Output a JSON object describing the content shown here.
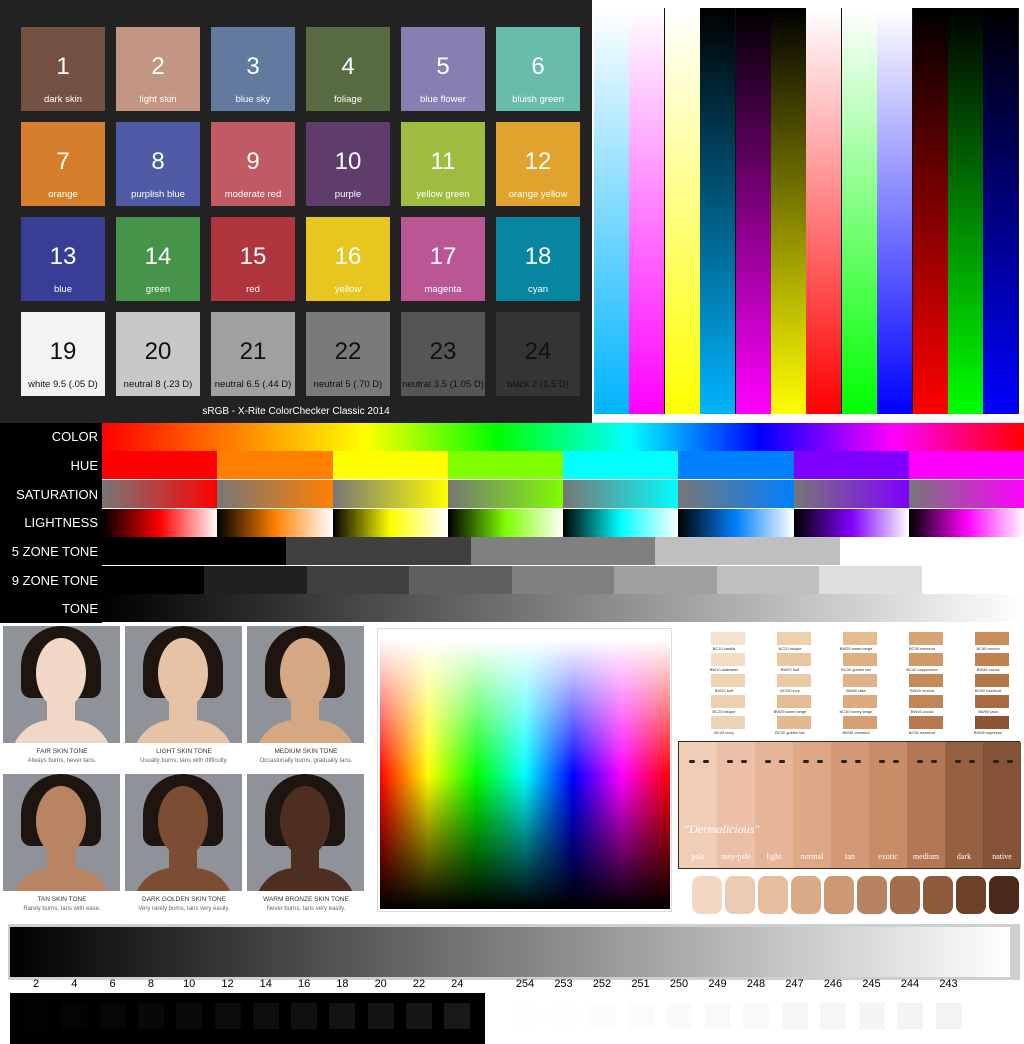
{
  "colorchecker": {
    "caption": "sRGB - X-Rite ColorChecker Classic 2014",
    "patches": [
      {
        "num": "1",
        "name": "dark skin",
        "color": "#735244",
        "dark": false
      },
      {
        "num": "2",
        "name": "light skin",
        "color": "#c29682",
        "dark": false
      },
      {
        "num": "3",
        "name": "blue sky",
        "color": "#627a9d",
        "dark": false
      },
      {
        "num": "4",
        "name": "foliage",
        "color": "#576c43",
        "dark": false
      },
      {
        "num": "5",
        "name": "blue flower",
        "color": "#8580b1",
        "dark": false
      },
      {
        "num": "6",
        "name": "bluish green",
        "color": "#67bdaa",
        "dark": false
      },
      {
        "num": "7",
        "name": "orange",
        "color": "#d67e2c",
        "dark": false
      },
      {
        "num": "8",
        "name": "purplish blue",
        "color": "#505ba6",
        "dark": false
      },
      {
        "num": "9",
        "name": "moderate red",
        "color": "#c15a63",
        "dark": false
      },
      {
        "num": "10",
        "name": "purple",
        "color": "#5e3c6c",
        "dark": false
      },
      {
        "num": "11",
        "name": "yellow green",
        "color": "#9dbc40",
        "dark": false
      },
      {
        "num": "12",
        "name": "orange yellow",
        "color": "#e0a32e",
        "dark": false
      },
      {
        "num": "13",
        "name": "blue",
        "color": "#383d96",
        "dark": false
      },
      {
        "num": "14",
        "name": "green",
        "color": "#469449",
        "dark": false
      },
      {
        "num": "15",
        "name": "red",
        "color": "#af363c",
        "dark": false
      },
      {
        "num": "16",
        "name": "yellow",
        "color": "#e7c71f",
        "dark": false
      },
      {
        "num": "17",
        "name": "magenta",
        "color": "#bb5695",
        "dark": false
      },
      {
        "num": "18",
        "name": "cyan",
        "color": "#0885a1",
        "dark": false
      },
      {
        "num": "19",
        "name": "white 9.5 (.05 D)",
        "color": "#f3f3f2",
        "dark": true
      },
      {
        "num": "20",
        "name": "neutral 8 (.23 D)",
        "color": "#c8c8c8",
        "dark": true
      },
      {
        "num": "21",
        "name": "neutral 6.5 (.44 D)",
        "color": "#a0a0a0",
        "dark": true
      },
      {
        "num": "22",
        "name": "neutral 5 (.70 D)",
        "color": "#7a7a79",
        "dark": true
      },
      {
        "num": "23",
        "name": "neutral 3.5 (1.05 D)",
        "color": "#555555",
        "dark": true
      },
      {
        "num": "24",
        "name": "black 2 (1.5 D)",
        "color": "#343434",
        "dark": true
      }
    ]
  },
  "vertical_bars": [
    "#ffffff,#00b4ff",
    "#ffffff,#ff00ff",
    "#ffffff,#ffff00",
    "#000000,#00b4ff",
    "#000000,#ff00ff",
    "#000000,#ffff00",
    "#ffffff,#ff0000",
    "#ffffff,#00ff00",
    "#ffffff,#0000ff",
    "#000000,#ff0000",
    "#000000,#00ff00",
    "#000000,#0000ff"
  ],
  "strips": {
    "labels": [
      "COLOR",
      "HUE",
      "SATURATION",
      "LIGHTNESS",
      "5 ZONE TONE",
      "9 ZONE TONE",
      "TONE"
    ],
    "hues": [
      "#ff0000",
      "#ff8000",
      "#ffff00",
      "#80ff00",
      "#00ffff",
      "#0080ff",
      "#8000ff",
      "#ff00ff"
    ]
  },
  "portraits": [
    {
      "title": "FAIR SKIN TONE",
      "sub": "Always burns, never tans.",
      "skin": "#f1d7c6"
    },
    {
      "title": "LIGHT SKIN TONE",
      "sub": "Usually burns, tans with difficulty.",
      "skin": "#e8c2a6"
    },
    {
      "title": "MEDIUM SKIN TONE",
      "sub": "Occasionally burns, gradually tans.",
      "skin": "#d5a883"
    },
    {
      "title": "TAN SKIN TONE",
      "sub": "Rarely burns, tans with ease.",
      "skin": "#b98462"
    },
    {
      "title": "DARK GOLDEN SKIN TONE",
      "sub": "Very rarely burns, tans very easily.",
      "skin": "#7d4d33"
    },
    {
      "title": "WARM BRONZE SKIN TONE",
      "sub": "Never burns, tans very easily.",
      "skin": "#4e2e20"
    }
  ],
  "foundation": {
    "columns": [
      [
        "BC10 vanilla",
        "BW10 alabaster",
        "BW20 buff",
        "BC20 bisque",
        "BC20 ivory"
      ],
      [
        "BC20 bisque",
        "BW20 buff",
        "BC25 ivory",
        "BW25 warm beige",
        "BC30 golden tan"
      ],
      [
        "BW25 warm beige",
        "BC30 golden tan",
        "BW30 latte",
        "BC30 honey beige",
        "BW35 chestnut"
      ],
      [
        "BC35 chestnut",
        "BC40 cappuccino",
        "BW45 mocha",
        "BW45 cocoa",
        "BC50 hazelnut"
      ],
      [
        "BC45 mocha",
        "BW45 cocoa",
        "BC50 hazelnut",
        "BW50 java",
        "BW55 espresso"
      ]
    ],
    "colors": [
      [
        "#f6e3cf",
        "#f3dcc4",
        "#efd3b5",
        "#eecfb1",
        "#ecd2b6"
      ],
      [
        "#efd0ae",
        "#ebc7a1",
        "#ebcaa6",
        "#e5bd94",
        "#e4b98f"
      ],
      [
        "#e6bb8d",
        "#e0b084",
        "#dfb389",
        "#dcaa7b",
        "#d6a070"
      ],
      [
        "#d7a474",
        "#cf9866",
        "#c58a58",
        "#c28656",
        "#b87a4c"
      ],
      [
        "#c78e5c",
        "#bf8352",
        "#b47647",
        "#a86a3e",
        "#8e5533"
      ]
    ]
  },
  "dermalicious": {
    "brand": "\"Dermalicious\"",
    "tones": [
      {
        "name": "pale",
        "color": "#f0cdb6"
      },
      {
        "name": "rosy-pale",
        "color": "#ecc0a6"
      },
      {
        "name": "light",
        "color": "#e6b598"
      },
      {
        "name": "normal",
        "color": "#dea886"
      },
      {
        "name": "tan",
        "color": "#d49a77"
      },
      {
        "name": "exotic",
        "color": "#c88c66"
      },
      {
        "name": "medium",
        "color": "#b47756"
      },
      {
        "name": "dark",
        "color": "#94603f"
      },
      {
        "name": "native",
        "color": "#845236"
      }
    ],
    "thumbs": [
      "#f3d7c3",
      "#eccbb3",
      "#e6bd9f",
      "#d8aa85",
      "#cc9974",
      "#b88260",
      "#a46d4c",
      "#8e5a3c",
      "#6e4229",
      "#4a2a1b"
    ]
  },
  "dark_ticks": [
    "2",
    "4",
    "6",
    "8",
    "10",
    "12",
    "14",
    "16",
    "18",
    "20",
    "22",
    "24"
  ],
  "light_ticks": [
    "254",
    "253",
    "252",
    "251",
    "250",
    "249",
    "248",
    "247",
    "246",
    "245",
    "244",
    "243"
  ]
}
